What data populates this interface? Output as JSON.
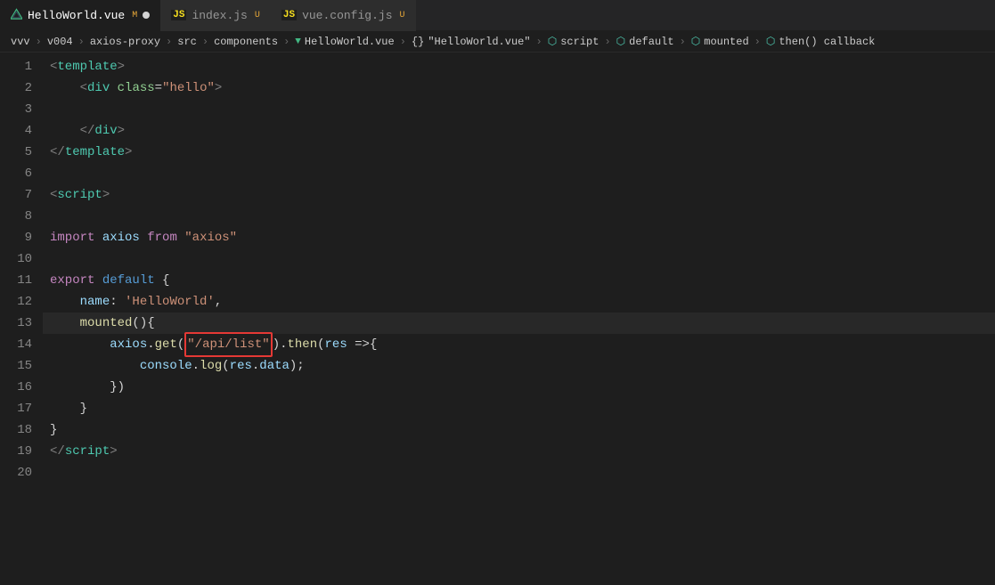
{
  "tabs": [
    {
      "id": "helloworld-vue",
      "label": "HelloWorld.vue",
      "type": "vue",
      "badge": "M",
      "dot": true,
      "active": true
    },
    {
      "id": "index-js",
      "label": "index.js",
      "type": "js",
      "badge": "U",
      "dot": false,
      "active": false
    },
    {
      "id": "vue-config-js",
      "label": "vue.config.js",
      "type": "js",
      "badge": "U",
      "dot": false,
      "active": false
    }
  ],
  "breadcrumb": [
    "vvv",
    ">",
    "v004",
    ">",
    "axios-proxy",
    ">",
    "src",
    ">",
    "components",
    ">",
    "HelloWorld.vue",
    ">",
    "{}",
    "\"HelloWorld.vue\"",
    ">",
    "script",
    ">",
    "default",
    ">",
    "mounted",
    ">",
    "then() callback"
  ],
  "code_lines": [
    {
      "num": 1,
      "tokens": [
        {
          "t": "tag-bracket",
          "v": "<"
        },
        {
          "t": "tag",
          "v": "template"
        },
        {
          "t": "tag-bracket",
          "v": ">"
        }
      ]
    },
    {
      "num": 2,
      "tokens": [
        {
          "t": "plain",
          "v": "    "
        },
        {
          "t": "tag-bracket",
          "v": "<"
        },
        {
          "t": "tag",
          "v": "div"
        },
        {
          "t": "plain",
          "v": " "
        },
        {
          "t": "attr",
          "v": "class"
        },
        {
          "t": "plain",
          "v": "="
        },
        {
          "t": "str",
          "v": "\"hello\""
        },
        {
          "t": "tag-bracket",
          "v": ">"
        }
      ]
    },
    {
      "num": 3,
      "tokens": []
    },
    {
      "num": 4,
      "tokens": [
        {
          "t": "plain",
          "v": "    "
        },
        {
          "t": "tag-bracket",
          "v": "</"
        },
        {
          "t": "tag",
          "v": "div"
        },
        {
          "t": "tag-bracket",
          "v": ">"
        }
      ]
    },
    {
      "num": 5,
      "tokens": [
        {
          "t": "tag-bracket",
          "v": "</"
        },
        {
          "t": "tag",
          "v": "template"
        },
        {
          "t": "tag-bracket",
          "v": ">"
        }
      ]
    },
    {
      "num": 6,
      "tokens": []
    },
    {
      "num": 7,
      "tokens": [
        {
          "t": "tag-bracket",
          "v": "<"
        },
        {
          "t": "tag",
          "v": "script"
        },
        {
          "t": "tag-bracket",
          "v": ">"
        }
      ]
    },
    {
      "num": 8,
      "tokens": []
    },
    {
      "num": 9,
      "tokens": [
        {
          "t": "kw2",
          "v": "import"
        },
        {
          "t": "plain",
          "v": " "
        },
        {
          "t": "name",
          "v": "axios"
        },
        {
          "t": "plain",
          "v": " "
        },
        {
          "t": "kw2",
          "v": "from"
        },
        {
          "t": "plain",
          "v": " "
        },
        {
          "t": "str",
          "v": "\"axios\""
        }
      ]
    },
    {
      "num": 10,
      "tokens": []
    },
    {
      "num": 11,
      "tokens": [
        {
          "t": "kw2",
          "v": "export"
        },
        {
          "t": "plain",
          "v": " "
        },
        {
          "t": "kw",
          "v": "default"
        },
        {
          "t": "plain",
          "v": " {"
        }
      ]
    },
    {
      "num": 12,
      "tokens": [
        {
          "t": "plain",
          "v": "    "
        },
        {
          "t": "prop",
          "v": "name"
        },
        {
          "t": "plain",
          "v": ": "
        },
        {
          "t": "str",
          "v": "'HelloWorld'"
        },
        {
          "t": "plain",
          "v": ","
        }
      ]
    },
    {
      "num": 13,
      "tokens": [
        {
          "t": "plain",
          "v": "    "
        },
        {
          "t": "fn",
          "v": "mounted"
        },
        {
          "t": "plain",
          "v": "(){"
        }
      ],
      "has_cursor_line": true
    },
    {
      "num": 14,
      "tokens": [
        {
          "t": "plain",
          "v": "        "
        },
        {
          "t": "name",
          "v": "axios"
        },
        {
          "t": "plain",
          "v": "."
        },
        {
          "t": "fn",
          "v": "get"
        },
        {
          "t": "plain",
          "v": "("
        },
        {
          "t": "red-outline-str",
          "v": "\"/api/list\""
        },
        {
          "t": "plain",
          "v": ")."
        },
        {
          "t": "fn",
          "v": "then"
        },
        {
          "t": "plain",
          "v": "("
        },
        {
          "t": "name",
          "v": "res"
        },
        {
          "t": "plain",
          "v": " =>{"
        }
      ]
    },
    {
      "num": 15,
      "tokens": [
        {
          "t": "plain",
          "v": "            "
        },
        {
          "t": "name",
          "v": "console"
        },
        {
          "t": "plain",
          "v": "."
        },
        {
          "t": "fn",
          "v": "log"
        },
        {
          "t": "plain",
          "v": "("
        },
        {
          "t": "name",
          "v": "res"
        },
        {
          "t": "plain",
          "v": "."
        },
        {
          "t": "name",
          "v": "data"
        },
        {
          "t": "plain",
          "v": ");"
        }
      ]
    },
    {
      "num": 16,
      "tokens": [
        {
          "t": "plain",
          "v": "        "
        },
        {
          "t": "plain",
          "v": "})"
        }
      ]
    },
    {
      "num": 17,
      "tokens": [
        {
          "t": "plain",
          "v": "    }"
        }
      ]
    },
    {
      "num": 18,
      "tokens": [
        {
          "t": "plain",
          "v": "}"
        }
      ]
    },
    {
      "num": 19,
      "tokens": [
        {
          "t": "tag-bracket",
          "v": "</"
        },
        {
          "t": "tag",
          "v": "script"
        },
        {
          "t": "tag-bracket",
          "v": ">"
        }
      ]
    },
    {
      "num": 20,
      "tokens": []
    }
  ]
}
